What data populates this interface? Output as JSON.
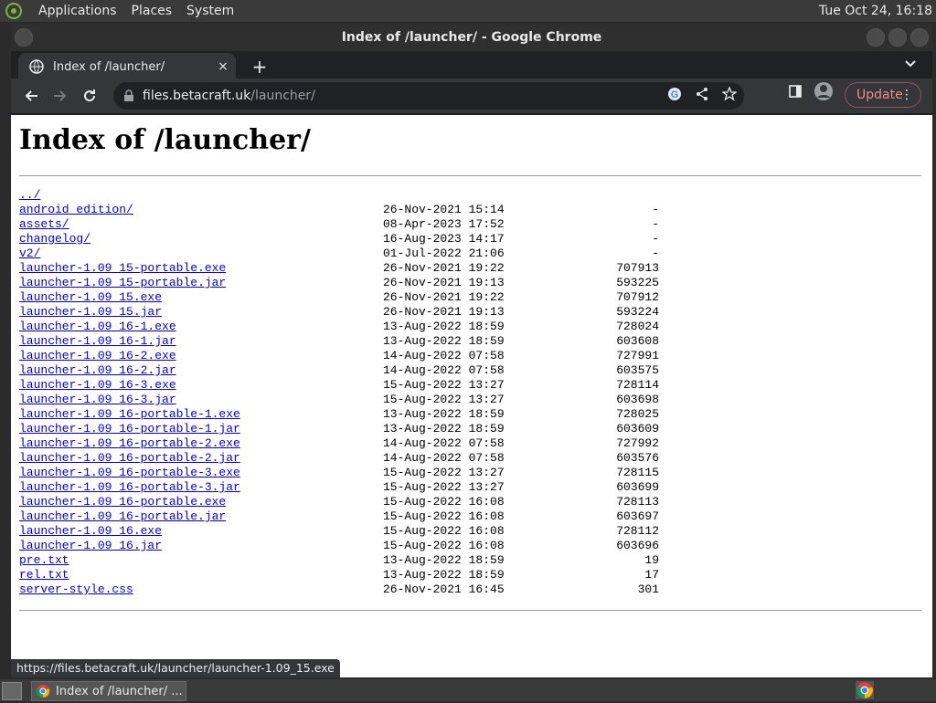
{
  "panel": {
    "menus": [
      "Applications",
      "Places",
      "System"
    ],
    "clock": "Tue Oct 24, 16:18"
  },
  "window": {
    "title": "Index of /launcher/ - Google Chrome"
  },
  "tab": {
    "label": "Index of /launcher/",
    "close": "×",
    "new": "+"
  },
  "omnibox": {
    "host": "files.betacraft.uk",
    "path": "/launcher/"
  },
  "toolbar": {
    "update_label": "Update"
  },
  "page": {
    "heading": "Index of /launcher/",
    "entries": [
      {
        "name": "../",
        "date": "",
        "size": ""
      },
      {
        "name": "android edition/",
        "date": "26-Nov-2021 15:14",
        "size": "-"
      },
      {
        "name": "assets/",
        "date": "08-Apr-2023 17:52",
        "size": "-"
      },
      {
        "name": "changelog/",
        "date": "16-Aug-2023 14:17",
        "size": "-"
      },
      {
        "name": "v2/",
        "date": "01-Jul-2022 21:06",
        "size": "-"
      },
      {
        "name": "launcher-1.09 15-portable.exe",
        "date": "26-Nov-2021 19:22",
        "size": "707913"
      },
      {
        "name": "launcher-1.09 15-portable.jar",
        "date": "26-Nov-2021 19:13",
        "size": "593225"
      },
      {
        "name": "launcher-1.09 15.exe",
        "date": "26-Nov-2021 19:22",
        "size": "707912"
      },
      {
        "name": "launcher-1.09 15.jar",
        "date": "26-Nov-2021 19:13",
        "size": "593224"
      },
      {
        "name": "launcher-1.09 16-1.exe",
        "date": "13-Aug-2022 18:59",
        "size": "728024"
      },
      {
        "name": "launcher-1.09 16-1.jar",
        "date": "13-Aug-2022 18:59",
        "size": "603608"
      },
      {
        "name": "launcher-1.09 16-2.exe",
        "date": "14-Aug-2022 07:58",
        "size": "727991"
      },
      {
        "name": "launcher-1.09 16-2.jar",
        "date": "14-Aug-2022 07:58",
        "size": "603575"
      },
      {
        "name": "launcher-1.09 16-3.exe",
        "date": "15-Aug-2022 13:27",
        "size": "728114"
      },
      {
        "name": "launcher-1.09 16-3.jar",
        "date": "15-Aug-2022 13:27",
        "size": "603698"
      },
      {
        "name": "launcher-1.09 16-portable-1.exe",
        "date": "13-Aug-2022 18:59",
        "size": "728025"
      },
      {
        "name": "launcher-1.09 16-portable-1.jar",
        "date": "13-Aug-2022 18:59",
        "size": "603609"
      },
      {
        "name": "launcher-1.09 16-portable-2.exe",
        "date": "14-Aug-2022 07:58",
        "size": "727992"
      },
      {
        "name": "launcher-1.09 16-portable-2.jar",
        "date": "14-Aug-2022 07:58",
        "size": "603576"
      },
      {
        "name": "launcher-1.09 16-portable-3.exe",
        "date": "15-Aug-2022 13:27",
        "size": "728115"
      },
      {
        "name": "launcher-1.09 16-portable-3.jar",
        "date": "15-Aug-2022 13:27",
        "size": "603699"
      },
      {
        "name": "launcher-1.09 16-portable.exe",
        "date": "15-Aug-2022 16:08",
        "size": "728113"
      },
      {
        "name": "launcher-1.09 16-portable.jar",
        "date": "15-Aug-2022 16:08",
        "size": "603697"
      },
      {
        "name": "launcher-1.09 16.exe",
        "date": "15-Aug-2022 16:08",
        "size": "728112"
      },
      {
        "name": "launcher-1.09 16.jar",
        "date": "15-Aug-2022 16:08",
        "size": "603696"
      },
      {
        "name": "pre.txt",
        "date": "13-Aug-2022 18:59",
        "size": "19"
      },
      {
        "name": "rel.txt",
        "date": "13-Aug-2022 18:59",
        "size": "17"
      },
      {
        "name": "server-style.css",
        "date": "26-Nov-2021 16:45",
        "size": "301"
      }
    ]
  },
  "status_url": "https://files.betacraft.uk/launcher/launcher-1.09_15.exe",
  "taskbar": {
    "task_label": "Index of /launcher/ ..."
  },
  "colors": {
    "link": "#0000ee",
    "update_accent": "#f28b82"
  }
}
